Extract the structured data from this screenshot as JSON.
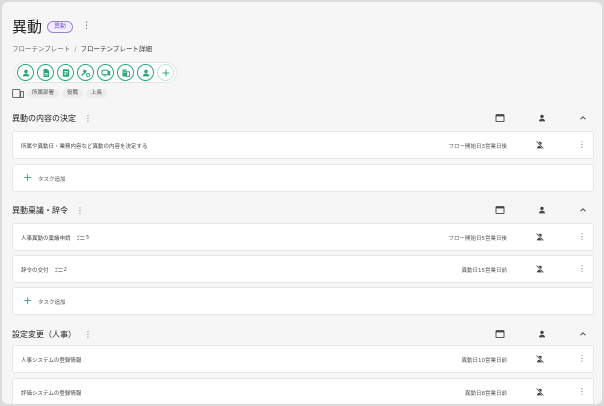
{
  "page": {
    "title": "異動",
    "badge": "異動",
    "more_label": "⋮"
  },
  "breadcrumb": {
    "parent": "フローテンプレート",
    "separator": "/",
    "current": "フローテンプレート詳細"
  },
  "role_icons": [
    "person-icon",
    "document-icon",
    "form-icon",
    "settings-person-icon",
    "device-icon",
    "building-icon",
    "person-icon",
    "plus-icon"
  ],
  "assignees": {
    "chips": [
      "所属部署",
      "役職",
      "上長"
    ]
  },
  "colors": {
    "accent": "#2aa876",
    "badge": "#7a5bd0"
  },
  "sections": [
    {
      "title": "異動の内容の決定",
      "tasks": [
        {
          "label": "所属や異動日・業務内容など異動の内容を決定する",
          "count": "",
          "due": "フロー開始日3営業日後"
        }
      ],
      "add_label": "タスク追加"
    },
    {
      "title": "異動稟議・辞令",
      "tasks": [
        {
          "label": "人事異動の稟議申請",
          "count": "3",
          "due": "フロー開始日5営業日後"
        },
        {
          "label": "辞令の交付",
          "count": "2",
          "due": "異動日15営業日前"
        }
      ],
      "add_label": "タスク追加"
    },
    {
      "title": "設定変更（人事）",
      "tasks": [
        {
          "label": "人事システムの登録情報",
          "count": "",
          "due": "異動日10営業日前"
        },
        {
          "label": "評価システムの登録情報",
          "count": "",
          "due": "異動日8営業日前"
        }
      ]
    }
  ]
}
